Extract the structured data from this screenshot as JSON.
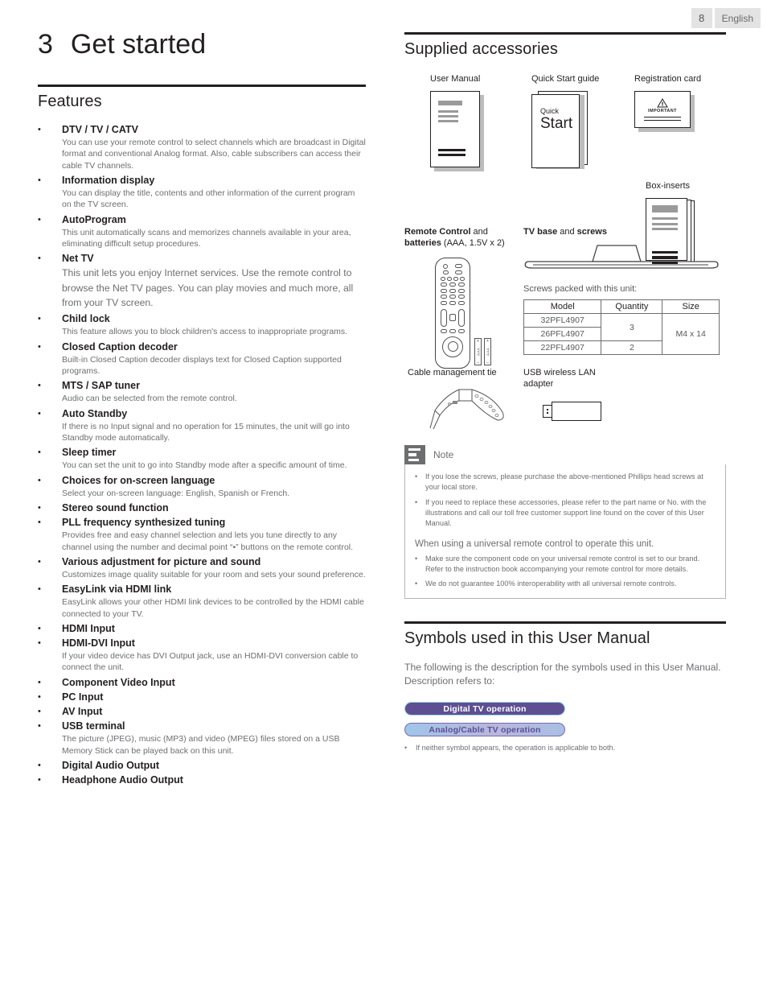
{
  "header": {
    "page_number": "8",
    "language": "English"
  },
  "chapter": {
    "number": "3",
    "title": "Get started"
  },
  "features_section": {
    "title": "Features",
    "items": [
      {
        "title": "DTV / TV / CATV",
        "desc": "You can use your remote control to select channels which are broadcast in Digital format and conventional Analog format. Also, cable subscribers can access their cable TV channels."
      },
      {
        "title": "Information display",
        "desc": "You can display the title, contents and other information of the current program on the TV screen."
      },
      {
        "title": "AutoProgram",
        "desc": "This unit automatically scans and memorizes channels available in your area, eliminating difficult setup procedures."
      },
      {
        "title": "Net TV",
        "desc": "This unit lets you enjoy Internet services. Use the remote control to browse the Net TV pages. You can play movies and much more, all from your TV screen."
      },
      {
        "title": "Child lock",
        "desc": "This feature allows you to block children's access to inappropriate programs."
      },
      {
        "title": "Closed Caption decoder",
        "desc": "Built-in Closed Caption decoder displays text for Closed Caption supported programs."
      },
      {
        "title": "MTS / SAP tuner",
        "desc": "Audio can be selected from the remote control."
      },
      {
        "title": "Auto Standby",
        "desc": "If there is no Input signal and no operation for 15 minutes, the unit will go into Standby mode automatically."
      },
      {
        "title": "Sleep timer",
        "desc": "You can set the unit to go into Standby mode after a specific amount of time."
      },
      {
        "title": "Choices for on-screen language",
        "desc": "Select your on-screen language:  English, Spanish or French."
      },
      {
        "title": "Stereo sound function",
        "desc": ""
      },
      {
        "title": "PLL frequency synthesized tuning",
        "desc": "Provides free and easy channel selection and lets you tune directly to any channel using the number and decimal point “•” buttons on the remote control."
      },
      {
        "title": "Various adjustment for picture and sound",
        "desc": "Customizes image quality suitable for your room and sets your sound preference."
      },
      {
        "title": "EasyLink via HDMI link",
        "desc": "EasyLink allows your other HDMI link devices to be controlled by the HDMI cable connected to your TV."
      },
      {
        "title": "HDMI Input",
        "desc": ""
      },
      {
        "title": "HDMI-DVI Input",
        "desc": "If your video device has DVI Output jack, use an HDMI-DVI conversion cable to connect the unit."
      },
      {
        "title": "Component Video Input",
        "desc": ""
      },
      {
        "title": "PC Input",
        "desc": ""
      },
      {
        "title": "AV Input",
        "desc": ""
      },
      {
        "title": "USB terminal",
        "desc": "The picture (JPEG), music (MP3) and video (MPEG) files stored on a USB Memory Stick can be played back on this unit."
      },
      {
        "title": "Digital Audio Output",
        "desc": ""
      },
      {
        "title": "Headphone Audio Output",
        "desc": ""
      }
    ]
  },
  "accessories_section": {
    "title": "Supplied accessories",
    "user_manual_label": "User Manual",
    "quick_start_label": "Quick Start guide",
    "quick_start_text_small": "Quick",
    "quick_start_text_big": "Start",
    "registration_label": "Registration card",
    "registration_important": "IMPORTANT",
    "box_inserts_label": "Box-inserts",
    "remote_label_bold": "Remote Control",
    "remote_label_rest": " and",
    "remote_label_line2_bold": "batteries",
    "remote_label_line2_rest": " (AAA, 1.5V x 2)",
    "battery_text": "AAA",
    "battery_plus": "+",
    "battery_minus": "–",
    "tv_base_label_bold": "TV base",
    "tv_base_label_mid": " and ",
    "tv_base_label_bold2": "screws",
    "screws_caption": "Screws packed with this unit:",
    "screws_table": {
      "headers": [
        "Model",
        "Quantity",
        "Size"
      ],
      "rows": [
        {
          "model": "32PFL4907"
        },
        {
          "model": "26PFL4907"
        },
        {
          "model": "22PFL4907"
        }
      ],
      "quantity_group_1": "3",
      "quantity_row_3": "2",
      "size": "M4 x 14"
    },
    "cable_tie_label": "Cable management tie",
    "usb_lan_label_line1": "USB wireless LAN",
    "usb_lan_label_line2": "adapter"
  },
  "note": {
    "label": "Note",
    "items": [
      "If you lose the screws, please purchase the above-mentioned Phillips head screws at your local store.",
      "If you need to replace these accessories, please refer to the part name or No. with the illustrations and call our toll free customer support line found on the cover of this User Manual."
    ],
    "subheading": "When using a universal remote control to operate this unit.",
    "sub_items": [
      "Make sure the component code on your universal remote control is set to our brand. Refer to the instruction book accompanying your remote control for more details.",
      "We do not guarantee 100% interoperability with all universal remote controls."
    ]
  },
  "symbols_section": {
    "title": "Symbols used in this User Manual",
    "intro": "The following is the description for the symbols used in this User Manual. Description refers to:",
    "badge_digital": "Digital TV operation",
    "badge_analog": "Analog/Cable TV operation",
    "footnote": "If neither symbol appears, the operation is applicable to both.",
    "colors": {
      "digital_bg": "#5d4f92",
      "digital_border": "#9fd3e8",
      "analog_text": "#5d4f92",
      "analog_border": "#7b69ab"
    }
  },
  "bullet": "•"
}
